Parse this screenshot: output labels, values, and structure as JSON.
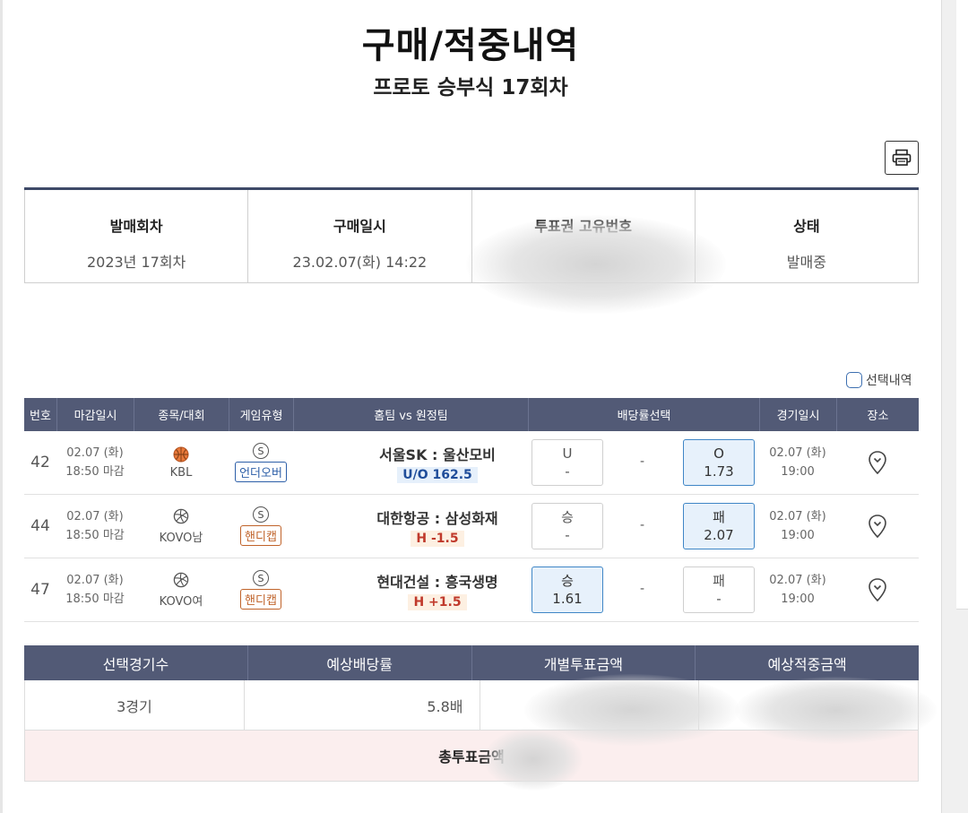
{
  "header": {
    "title": "구매/적중내역",
    "subtitle": "프로토 승부식 17회차"
  },
  "icons": {
    "print": "printer-icon",
    "location": "location-pin-icon",
    "basketball": "basketball-icon",
    "volleyball": "volleyball-icon"
  },
  "info": {
    "round_label": "발매회차",
    "round_value": "2023년 17회차",
    "purchase_label": "구매일시",
    "purchase_value": "23.02.07(화) 14:22",
    "ticket_label": "투표권 고유번호",
    "status_label": "상태",
    "status_value": "발매중"
  },
  "selection_toggle": "선택내역",
  "match_table": {
    "headers": [
      "번호",
      "마감일시",
      "종목/대회",
      "게임유형",
      "홈팀 vs 원정팀",
      "배당률선택",
      "경기일시",
      "장소"
    ],
    "rows": [
      {
        "no": "42",
        "deadline_date": "02.07 (화)",
        "deadline_time": "18:50 마감",
        "sport": "KBL",
        "sport_icon": "basketball-icon",
        "type_badge": "S",
        "game_type": "언더오버",
        "teams": "서울SK : 울산모비",
        "line": "U/O 162.5",
        "left_top": "U",
        "left_bottom": "-",
        "mid": "-",
        "right_top": "O",
        "right_bottom": "1.73",
        "selected": "right",
        "match_date": "02.07 (화)",
        "match_time": "19:00"
      },
      {
        "no": "44",
        "deadline_date": "02.07 (화)",
        "deadline_time": "18:50 마감",
        "sport": "KOVO남",
        "sport_icon": "volleyball-icon",
        "type_badge": "S",
        "game_type": "핸디캡",
        "teams": "대한항공 : 삼성화재",
        "line": "H -1.5",
        "left_top": "승",
        "left_bottom": "-",
        "mid": "-",
        "right_top": "패",
        "right_bottom": "2.07",
        "selected": "right",
        "match_date": "02.07 (화)",
        "match_time": "19:00"
      },
      {
        "no": "47",
        "deadline_date": "02.07 (화)",
        "deadline_time": "18:50 마감",
        "sport": "KOVO여",
        "sport_icon": "volleyball-icon",
        "type_badge": "S",
        "game_type": "핸디캡",
        "teams": "현대건설 : 흥국생명",
        "line": "H +1.5",
        "left_top": "승",
        "left_bottom": "1.61",
        "mid": "-",
        "right_top": "패",
        "right_bottom": "-",
        "selected": "left",
        "match_date": "02.07 (화)",
        "match_time": "19:00"
      }
    ]
  },
  "summary": {
    "headers": [
      "선택경기수",
      "예상배당률",
      "개별투표금액",
      "예상적중금액"
    ],
    "games": "3경기",
    "odds": "5.8배",
    "total_label": "총투표금액"
  },
  "colors": {
    "header_bg": "#525a76",
    "selected_odds_bg": "#e7f1fb",
    "selected_odds_border": "#3f86c6",
    "total_row_bg": "#fbeeee"
  }
}
